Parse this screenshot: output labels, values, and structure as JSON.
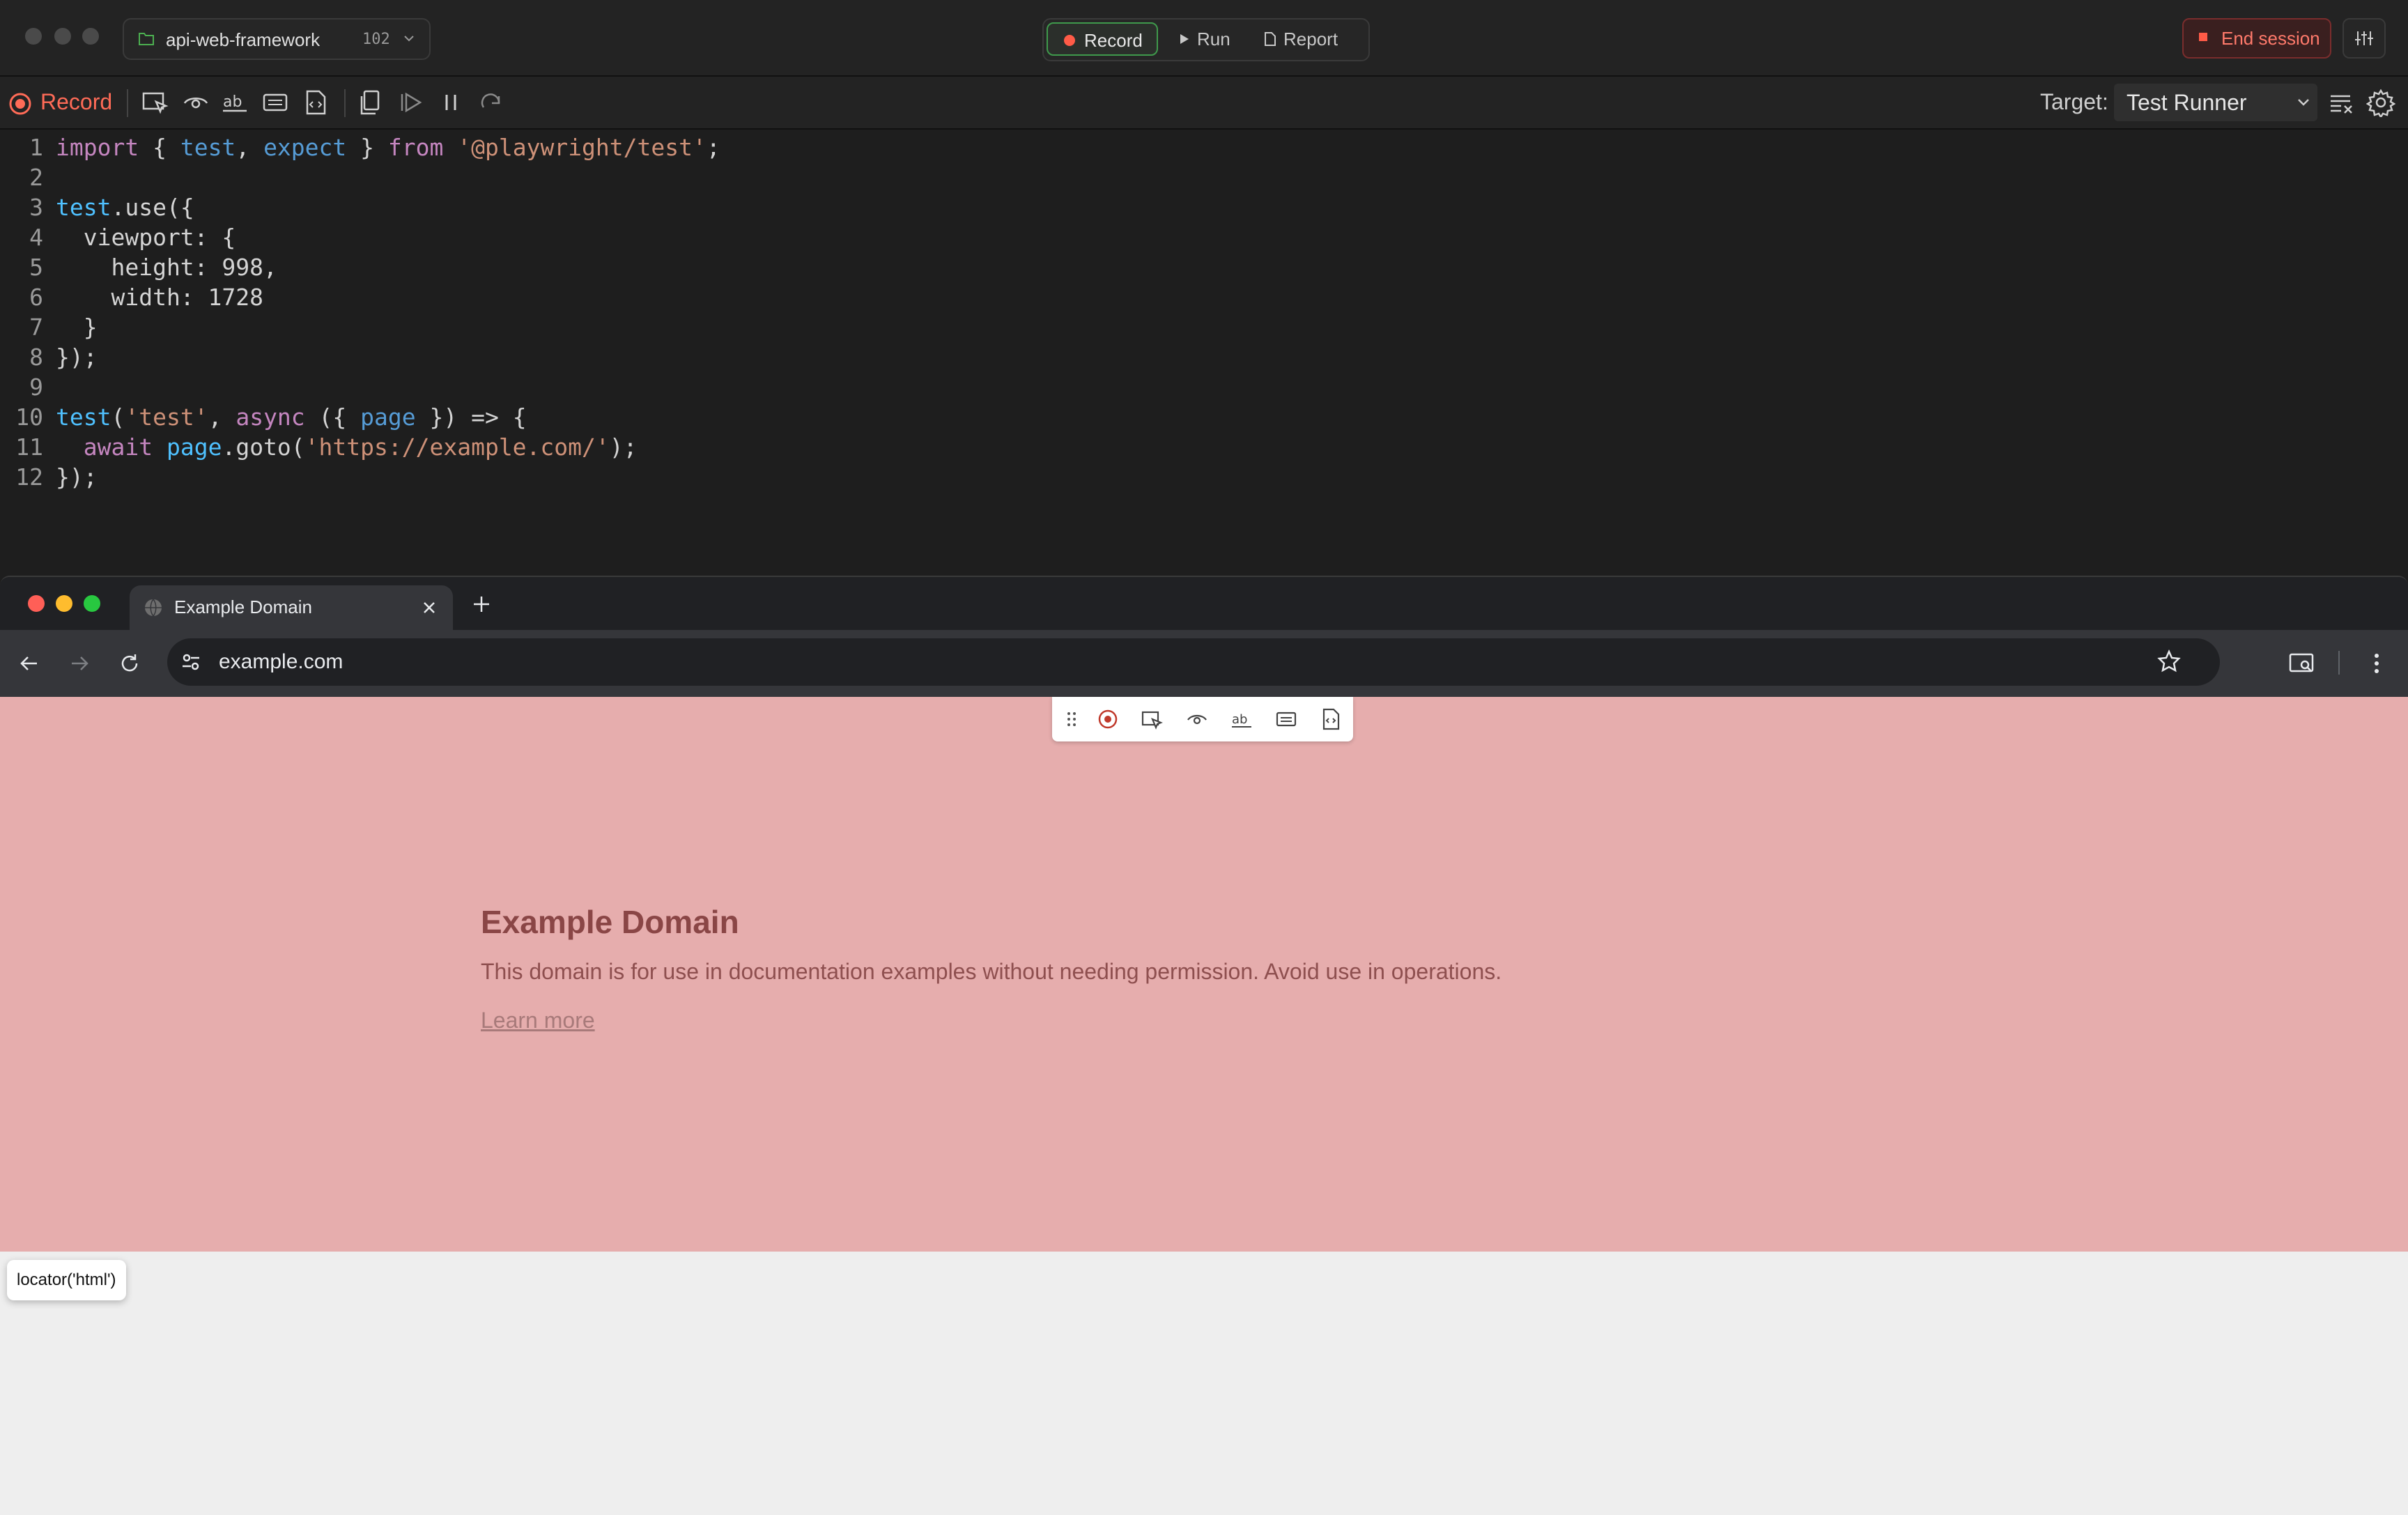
{
  "titlebar": {
    "project_name": "api-web-framework",
    "project_count": "102",
    "modes": {
      "record": "Record",
      "run": "Run",
      "report": "Report"
    },
    "end_session": "End session"
  },
  "recorder": {
    "record_label": "Record",
    "target_label": "Target:",
    "target_value": "Test Runner"
  },
  "code_lines": [
    "1",
    "2",
    "3",
    "4",
    "5",
    "6",
    "7",
    "8",
    "9",
    "10",
    "11",
    "12"
  ],
  "code": {
    "l1": [
      "import",
      " { ",
      "test",
      ", ",
      "expect",
      " } ",
      "from",
      " ",
      "'@playwright/test'",
      ";"
    ],
    "l3": [
      "test",
      ".use({"
    ],
    "l4": "  viewport: {",
    "l5": [
      "    height: ",
      "998",
      ","
    ],
    "l6": [
      "    width: ",
      "1728"
    ],
    "l7": "  }",
    "l8": "});",
    "l10": [
      "test",
      "(",
      "'test'",
      ", ",
      "async",
      " ({ ",
      "page",
      " }) => {"
    ],
    "l11": [
      "  ",
      "await",
      " ",
      "page",
      ".goto(",
      "'https://example.com/'",
      ");"
    ],
    "l12": "});"
  },
  "browser": {
    "tab_title": "Example Domain",
    "url": "example.com"
  },
  "page": {
    "title": "Example Domain",
    "description": "This domain is for use in documentation examples without needing permission. Avoid use in operations.",
    "link": "Learn more"
  },
  "locator_tooltip": "locator('html')",
  "colors": {
    "highlight": "#e6adad",
    "record_red": "#ff6b57",
    "end_session_red": "#ff7a6b",
    "active_green": "#3f9a4c"
  }
}
